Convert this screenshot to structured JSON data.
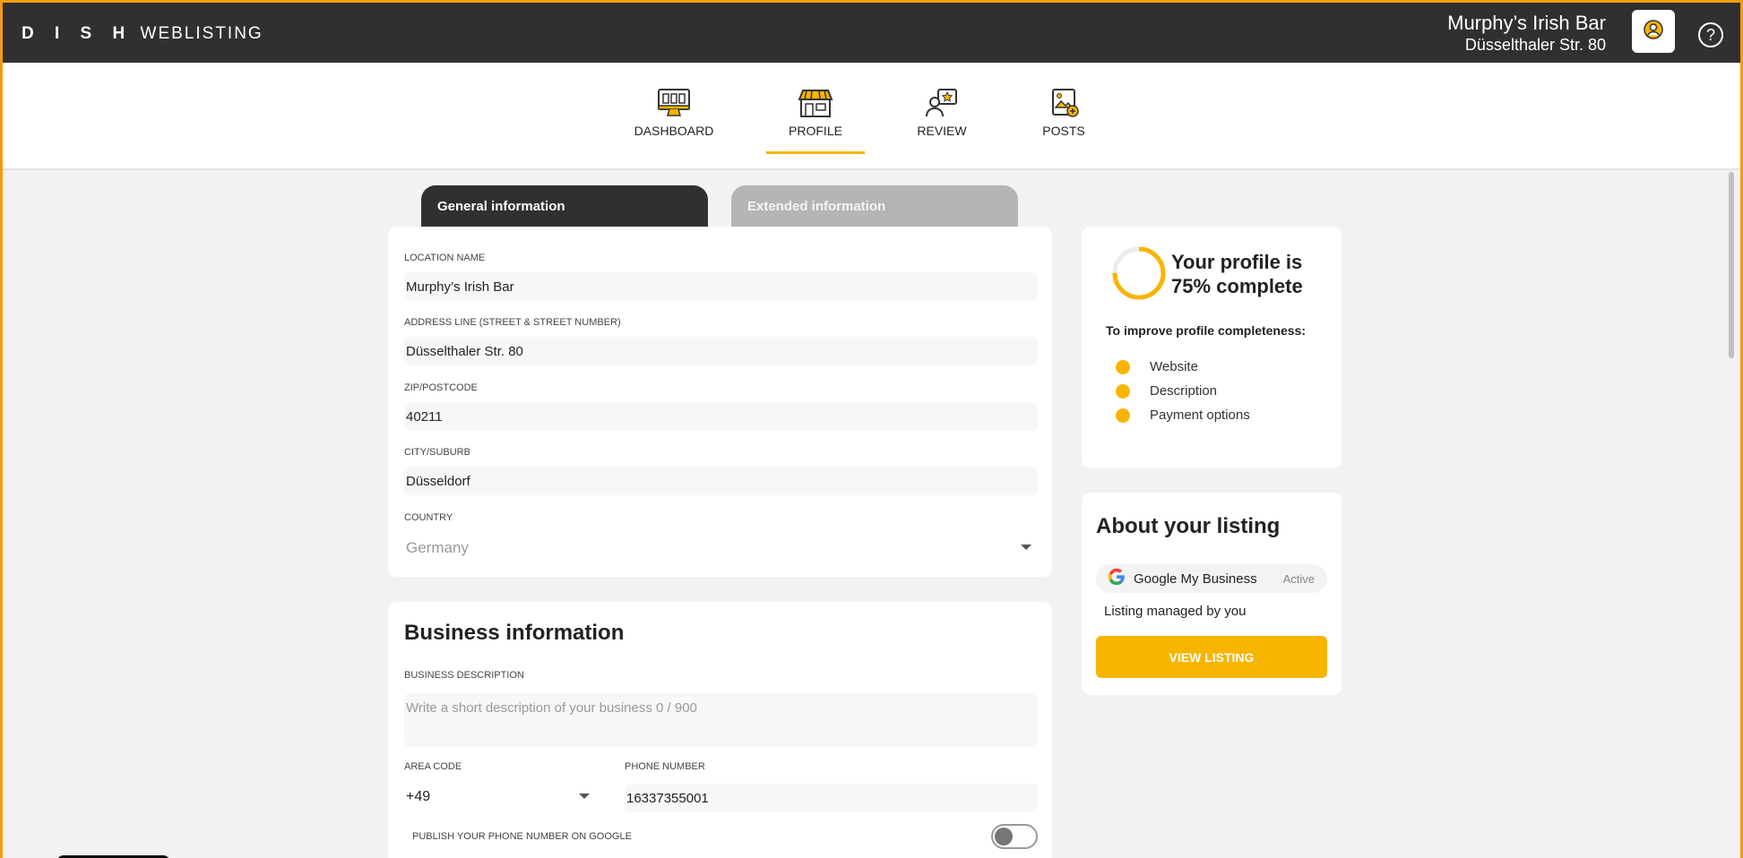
{
  "header": {
    "logo_brand": "D I S H",
    "logo_product": "WEBLISTING",
    "venue_name": "Murphy’s Irish Bar",
    "venue_address": "Düsselthaler Str. 80",
    "profile_icon": "user-circle-icon",
    "help_icon": "question-circle-icon"
  },
  "nav": {
    "items": [
      {
        "label": "DASHBOARD",
        "icon": "monitor-icon"
      },
      {
        "label": "PROFILE",
        "icon": "storefront-icon",
        "active": true
      },
      {
        "label": "REVIEW",
        "icon": "review-star-icon"
      },
      {
        "label": "POSTS",
        "icon": "post-image-icon"
      }
    ]
  },
  "tabs": {
    "general": "General information",
    "extended": "Extended information"
  },
  "general": {
    "location_name_label": "LOCATION NAME",
    "location_name": "Murphy’s Irish Bar",
    "address_label": "ADDRESS LINE (STREET & STREET NUMBER)",
    "address": "Düsselthaler Str. 80",
    "zip_label": "ZIP/POSTCODE",
    "zip": "40211",
    "city_label": "CITY/SUBURB",
    "city": "Düsseldorf",
    "country_label": "COUNTRY",
    "country": "Germany"
  },
  "business": {
    "title": "Business information",
    "description_label": "BUSINESS DESCRIPTION",
    "description_placeholder": "Write a short description of your business 0 / 900",
    "area_code_label": "AREA CODE",
    "area_code": "+49",
    "phone_label": "PHONE NUMBER",
    "phone": "16337355001",
    "publish_phone_label": "PUBLISH YOUR PHONE NUMBER ON GOOGLE",
    "publish_phone_enabled": false
  },
  "progress": {
    "percent": 75,
    "text_line1": "Your profile is",
    "text_line2": "75% complete",
    "improve_title": "To improve profile completeness:",
    "items": [
      "Website",
      "Description",
      "Payment options"
    ],
    "accent_color": "#f7b500"
  },
  "listing": {
    "title": "About your listing",
    "provider": "Google My Business",
    "status": "Active",
    "managed_text": "Listing managed by you",
    "view_button": "VIEW LISTING"
  },
  "colors": {
    "topbar": "#303030",
    "accent": "#f7b500",
    "frame": "#f39c12"
  }
}
